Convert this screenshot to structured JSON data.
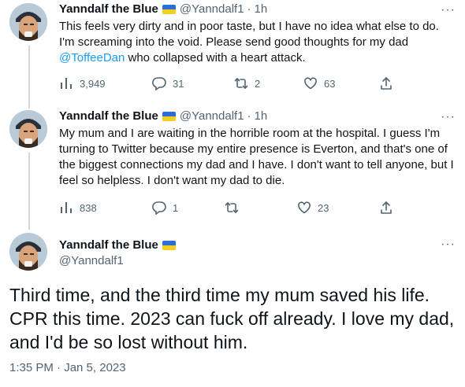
{
  "author": {
    "name": "Yanndalf the Blue",
    "handle": "@Yanndalf1",
    "flag": "ukraine-flag"
  },
  "tweets": [
    {
      "time": "1h",
      "text_before": "This feels very dirty and in poor taste, but I have no idea what else to do. I'm screaming into the void. Please send good thoughts for my dad ",
      "mention": "@ToffeeDan",
      "text_after": " who collapsed with a heart attack.",
      "views": "3,949",
      "replies": "31",
      "retweets": "2",
      "likes": "63"
    },
    {
      "time": "1h",
      "text": "My mum and I are waiting in the horrible room at the hospital. I guess I'm turning to Twitter because my entire presence is Everton, and that's one of the biggest connections my dad and I have. I don't want to tell anyone, but I feel so helpless. I don't want my dad to die.",
      "views": "838",
      "replies": "1",
      "retweets": "",
      "likes": "23"
    }
  ],
  "main_tweet": {
    "text": "Third time, and the third time my mum saved his life. CPR this time. 2023 can fuck off already. I love my dad, and I'd be so lost without him.",
    "timestamp": "1:35 PM · Jan 5, 2023"
  },
  "ui": {
    "more": "···",
    "dot": "·"
  },
  "colors": {
    "accent": "#1d9bf0",
    "secondary_text": "#536471",
    "thread_line": "#cfd9de"
  }
}
